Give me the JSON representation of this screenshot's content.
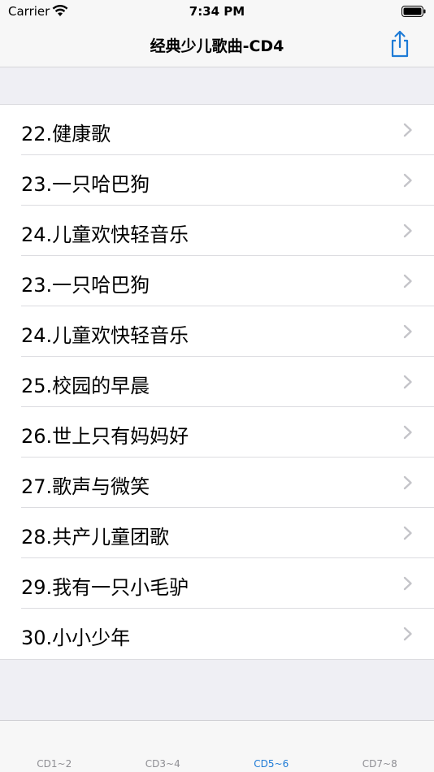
{
  "status_bar": {
    "carrier": "Carrier",
    "time": "7:34 PM"
  },
  "nav": {
    "title": "经典少儿歌曲-CD4",
    "share_icon": "share-icon"
  },
  "list": {
    "items": [
      {
        "label": "22.健康歌"
      },
      {
        "label": "23.一只哈巴狗"
      },
      {
        "label": "24.儿童欢快轻音乐"
      },
      {
        "label": "23.一只哈巴狗"
      },
      {
        "label": "24.儿童欢快轻音乐"
      },
      {
        "label": "25.校园的早晨"
      },
      {
        "label": "26.世上只有妈妈好"
      },
      {
        "label": "27.歌声与微笑"
      },
      {
        "label": "28.共产儿童团歌"
      },
      {
        "label": "29.我有一只小毛驴"
      },
      {
        "label": "30.小小少年"
      }
    ]
  },
  "tabs": [
    {
      "label": "CD1~2",
      "active": false
    },
    {
      "label": "CD3~4",
      "active": false
    },
    {
      "label": "CD5~6",
      "active": true
    },
    {
      "label": "CD7~8",
      "active": false
    }
  ],
  "colors": {
    "accent": "#1e7bd6",
    "inactive_tab": "#8e8e93",
    "background": "#efeff4"
  }
}
